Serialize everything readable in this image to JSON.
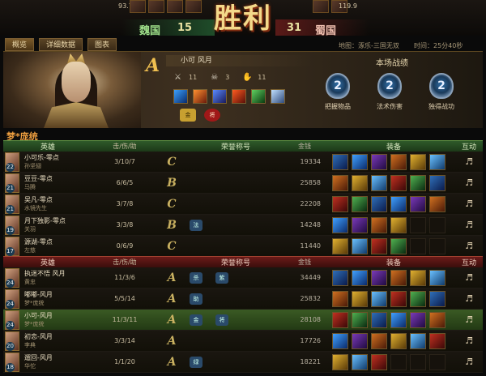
{
  "banner": {
    "victory": "胜利",
    "left_team": {
      "name": "魏国",
      "score": "15",
      "strip_num": "93.7"
    },
    "right_team": {
      "name": "蜀国",
      "score": "31",
      "strip_num": "119.9"
    }
  },
  "tabs": [
    "概览",
    "详细数据",
    "图表"
  ],
  "map_info": "地图：涿乐-三国无双",
  "time_info": "时间：25分40秒",
  "profile": {
    "player_label": "梦*庞统",
    "rank": "A",
    "name": "小可 风月",
    "kda": [
      "11",
      "3",
      "11"
    ],
    "kda_icons": [
      "sword-icon",
      "skull-icon",
      "helping-hand-icon"
    ],
    "battle_title": "本场战绩",
    "medals": [
      {
        "label": "把握物品",
        "icon": "medal-icon",
        "num": "2"
      },
      {
        "label": "法术伤害",
        "icon": "medal-icon",
        "num": "2"
      },
      {
        "label": "独得战功",
        "icon": "medal-icon",
        "num": "2"
      }
    ],
    "titles": [
      "金",
      "将"
    ]
  },
  "headers": {
    "wei": [
      "英雄",
      "击/伤/助",
      "荣誉称号",
      "金钱",
      "装备",
      "互动"
    ],
    "shu": [
      "英雄",
      "击/伤/助",
      "荣誉称号",
      "金钱",
      "装备",
      "互动"
    ]
  },
  "wei_rows": [
    {
      "player": "小可乐-零点",
      "hero": "孙坚翅",
      "level": "22",
      "kda": "3/10/7",
      "rank": "C",
      "titles": [],
      "gold": "19334"
    },
    {
      "player": "豆豆-零点",
      "hero": "马腾",
      "level": "21",
      "kda": "6/6/5",
      "rank": "B",
      "titles": [],
      "gold": "25858"
    },
    {
      "player": "吴凡-零点",
      "hero": "水镜先生",
      "level": "21",
      "kda": "3/7/8",
      "rank": "C",
      "titles": [],
      "gold": "22208"
    },
    {
      "player": "月下独影-零点",
      "hero": "关羽",
      "level": "19",
      "kda": "3/3/8",
      "rank": "B",
      "titles": [
        "法"
      ],
      "gold": "14248"
    },
    {
      "player": "源湖-零点",
      "hero": "左慈",
      "level": "17",
      "kda": "0/6/9",
      "rank": "C",
      "titles": [],
      "gold": "11440"
    }
  ],
  "shu_rows": [
    {
      "player": "执迷不悟 风月",
      "hero": "黄忠",
      "level": "24",
      "kda": "11/3/6",
      "rank": "A",
      "titles": [
        "杀",
        "紫"
      ],
      "gold": "34449",
      "highlight": false
    },
    {
      "player": "嘟嘟-风月",
      "hero": "梦*庞统",
      "level": "24",
      "kda": "5/5/14",
      "rank": "A",
      "titles": [
        "助"
      ],
      "gold": "25832",
      "highlight": false
    },
    {
      "player": "小可-风月",
      "hero": "梦*庞统",
      "level": "24",
      "kda": "11/3/11",
      "rank": "A",
      "titles": [
        "金",
        "将"
      ],
      "gold": "28108",
      "highlight": true
    },
    {
      "player": "初恋-风月",
      "hero": "李典",
      "level": "20",
      "kda": "3/3/14",
      "rank": "A",
      "titles": [],
      "gold": "17726",
      "highlight": false
    },
    {
      "player": "遛回-风月",
      "hero": "华佗",
      "level": "18",
      "kda": "1/1/20",
      "rank": "A",
      "titles": [
        "绿"
      ],
      "gold": "18221",
      "highlight": false
    }
  ],
  "interact_icon": "bell-icon"
}
